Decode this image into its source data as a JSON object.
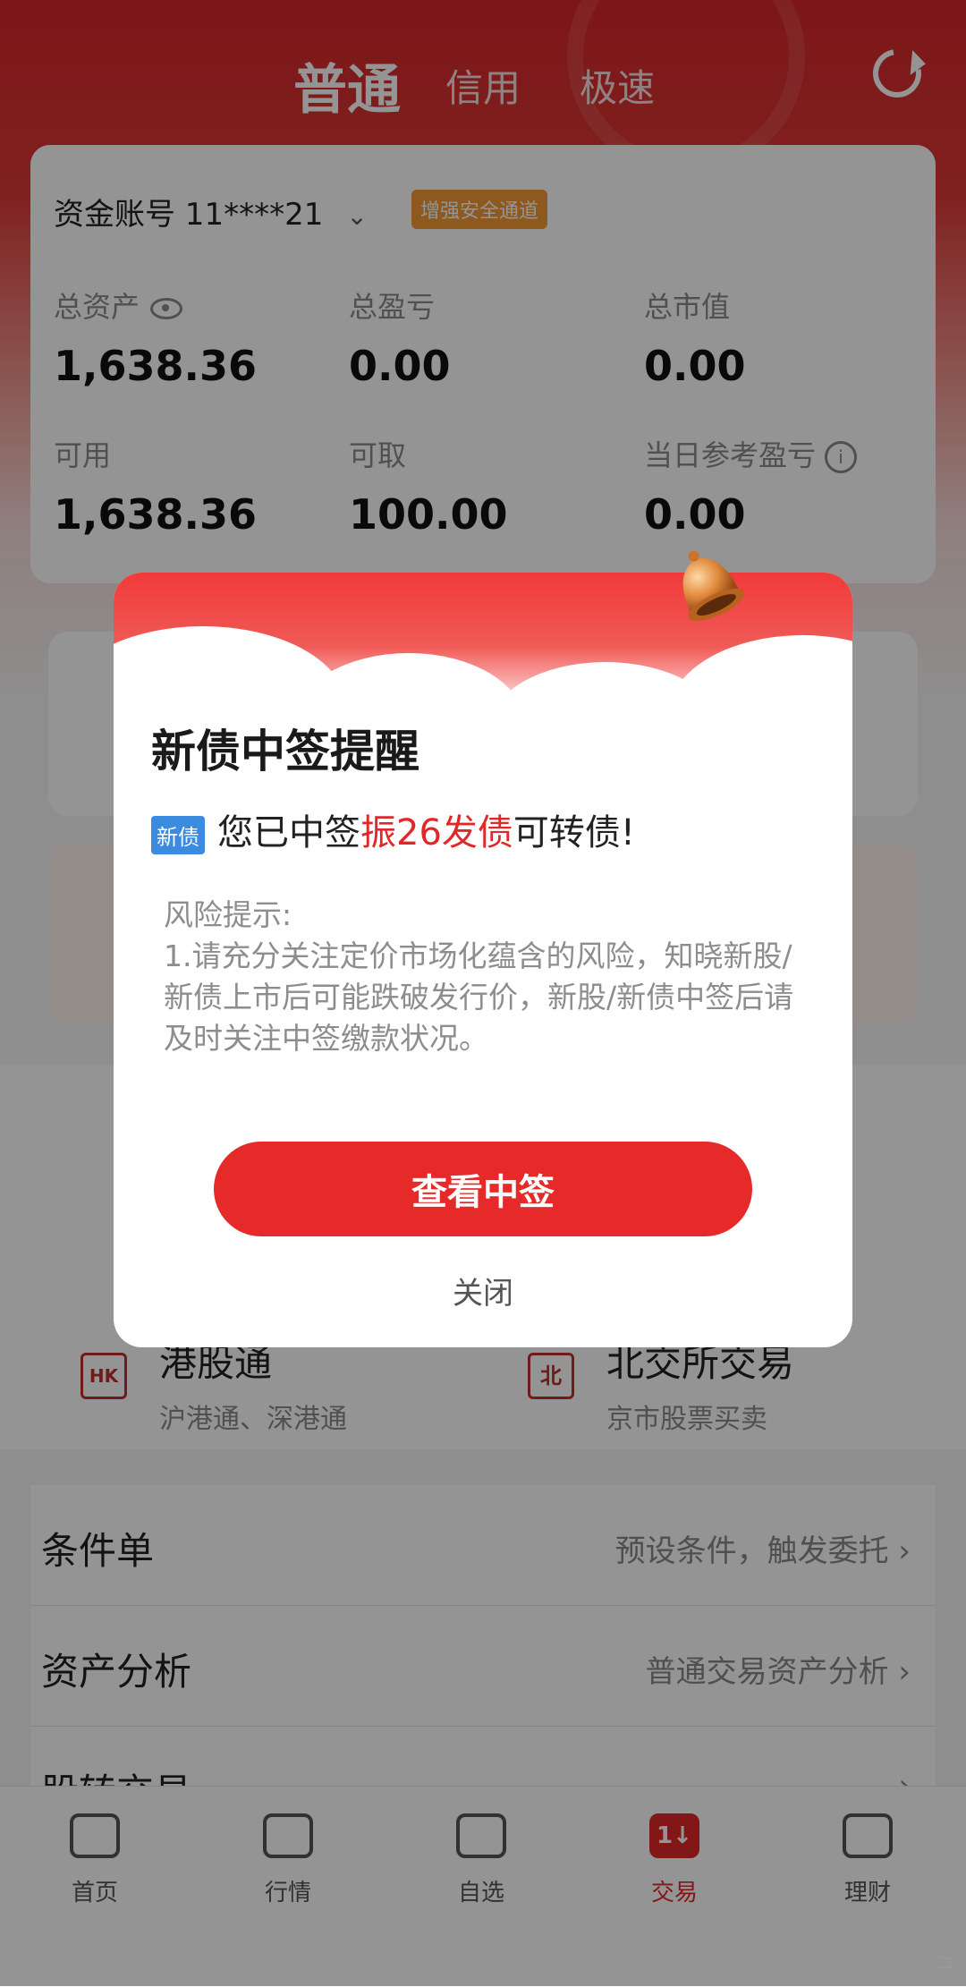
{
  "header": {
    "tabs": [
      {
        "label": "普通"
      },
      {
        "label": "信用"
      },
      {
        "label": "极速"
      }
    ]
  },
  "account": {
    "label": "资金账号 11****21",
    "security_badge": "增强安全通道",
    "stats": [
      {
        "label": "总资产",
        "value": "1,638.36"
      },
      {
        "label": "总盈亏",
        "value": "0.00"
      },
      {
        "label": "总市值",
        "value": "0.00"
      },
      {
        "label": "可用",
        "value": "1,638.36"
      },
      {
        "label": "可取",
        "value": "100.00"
      },
      {
        "label": "当日参考盈亏",
        "value": "0.00"
      }
    ]
  },
  "grid": {
    "hk": {
      "title": "港股通",
      "sub": "沪港通、深港通",
      "icon_text": "HK"
    },
    "bse": {
      "title": "北交所交易",
      "sub": "京市股票买卖",
      "icon_text": "北"
    }
  },
  "list": [
    {
      "label": "条件单",
      "hint": "预设条件，触发委托 ›"
    },
    {
      "label": "资产分析",
      "hint": "普通交易资产分析 ›"
    },
    {
      "label": "股转交易",
      "hint": "›"
    }
  ],
  "bottom_nav": [
    {
      "label": "首页"
    },
    {
      "label": "行情"
    },
    {
      "label": "自选"
    },
    {
      "label": "交易",
      "icon_text": "1↓"
    },
    {
      "label": "理财"
    }
  ],
  "dialog": {
    "title": "新债中签提醒",
    "tag": "新债",
    "msg_prefix": "您已中签",
    "msg_highlight": "振26发债",
    "msg_suffix": "可转债!",
    "risk_title": "风险提示:",
    "risk_body": "1.请充分关注定价市场化蕴含的风险，知晓新股/新债上市后可能跌破发行价，新股/新债中签后请及时关注中签缴款状况。",
    "primary_button": "查看中签",
    "close_label": "关闭"
  },
  "colors": {
    "brand_red": "#e02828",
    "badge_orange": "#f39a34",
    "tag_blue": "#3b8be0"
  }
}
